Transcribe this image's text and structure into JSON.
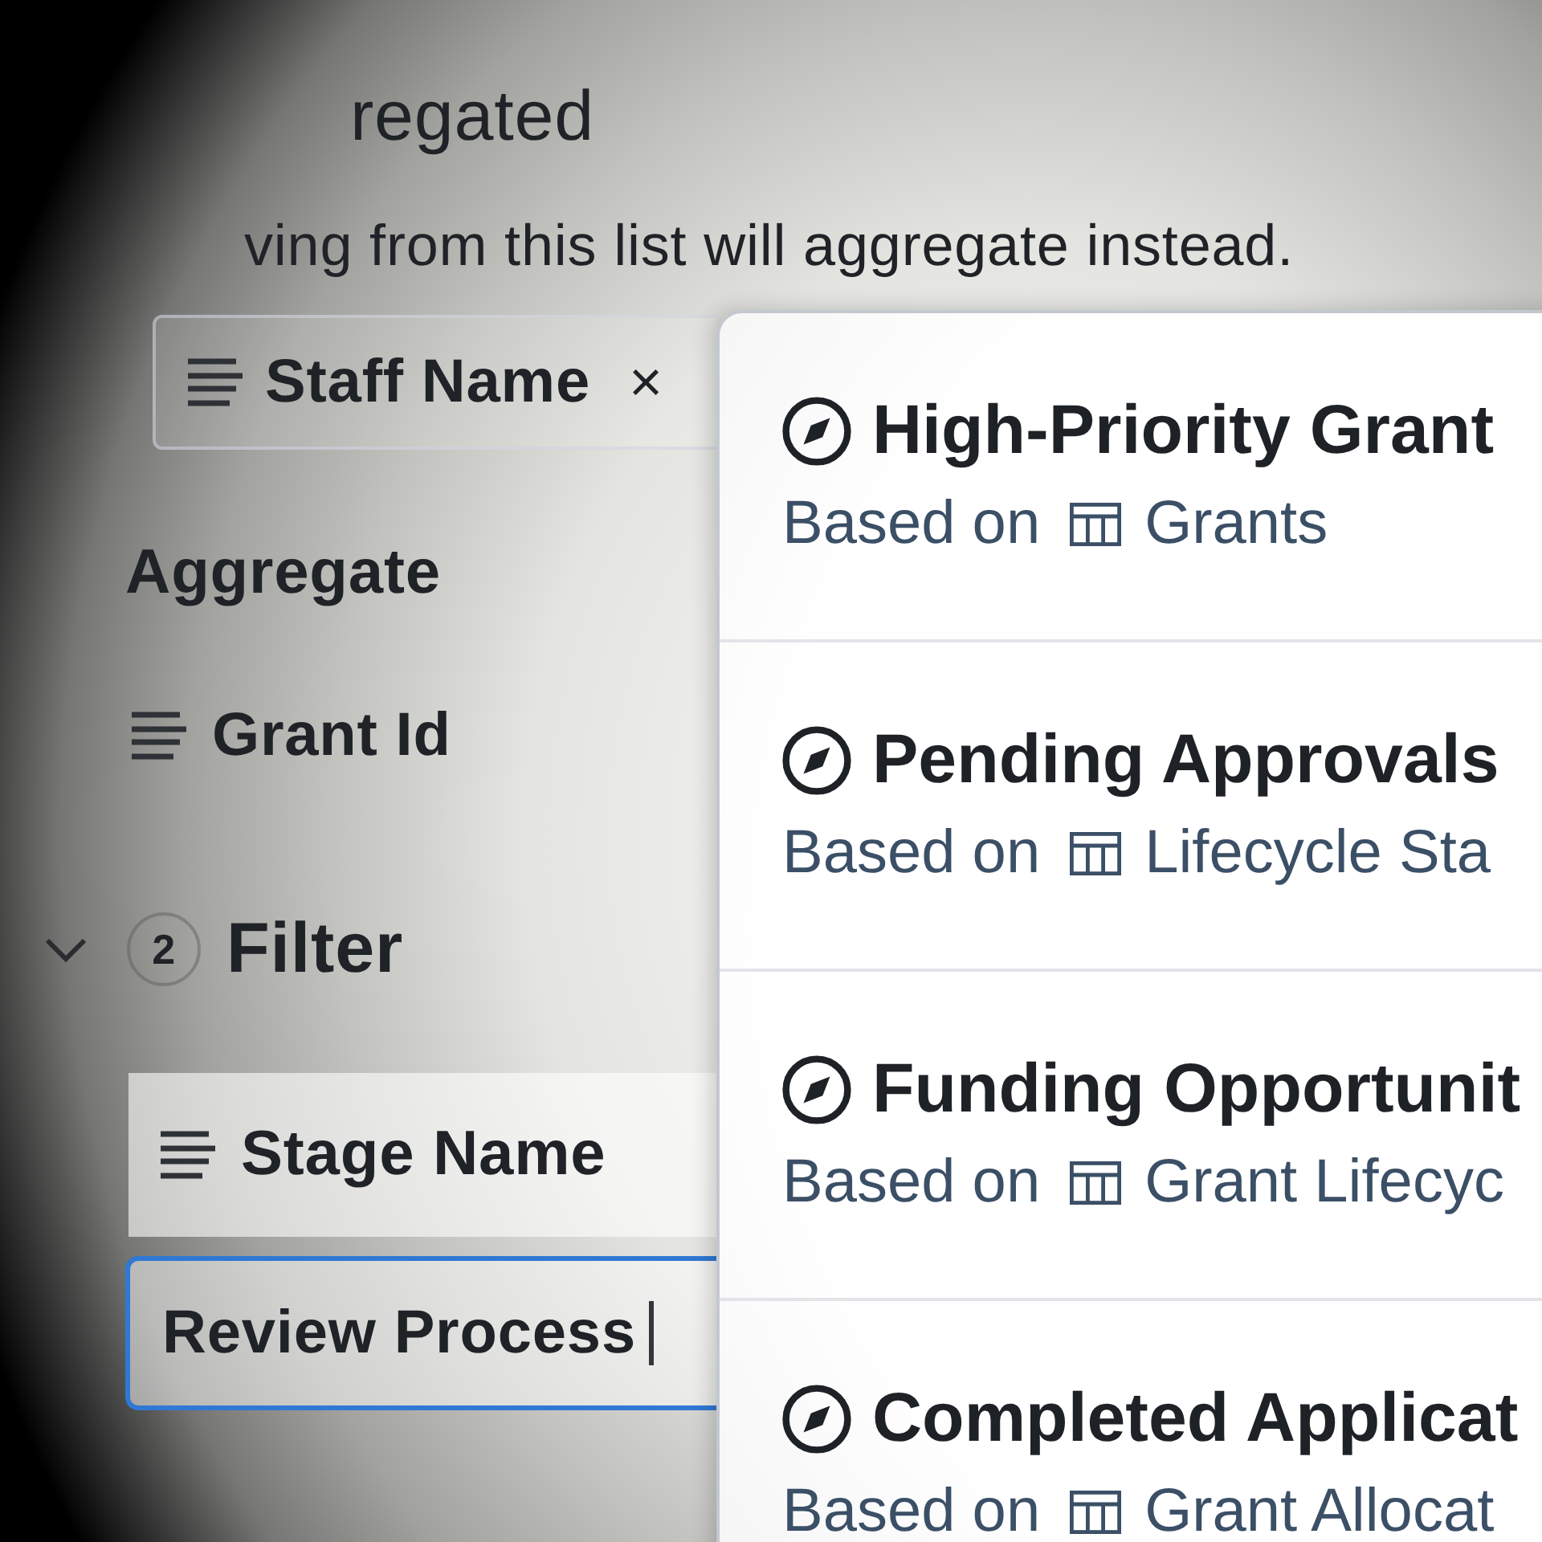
{
  "background_panel": {
    "heading": "regated",
    "description": "ving from this list will aggregate instead.",
    "group_by_chip": {
      "label": "Staff Name",
      "remove_symbol": "×"
    },
    "aggregate": {
      "label": "Aggregate",
      "fields": [
        {
          "name": "Grant Id"
        }
      ]
    },
    "filter": {
      "expanded": true,
      "count": "2",
      "label": "Filter",
      "field": {
        "name": "Stage Name"
      },
      "value_input": {
        "value": "Review Process",
        "focused": true
      }
    }
  },
  "dropdown": {
    "items": [
      {
        "title": "High-Priority Grant",
        "based_on": "Based on",
        "table": "Grants"
      },
      {
        "title": "Pending Approvals",
        "based_on": "Based on",
        "table": "Lifecycle Sta"
      },
      {
        "title": "Funding Opportunit",
        "based_on": "Based on",
        "table": "Grant Lifecyc"
      },
      {
        "title": "Completed Applicat",
        "based_on": "Based on",
        "table": "Grant Allocat"
      }
    ]
  }
}
